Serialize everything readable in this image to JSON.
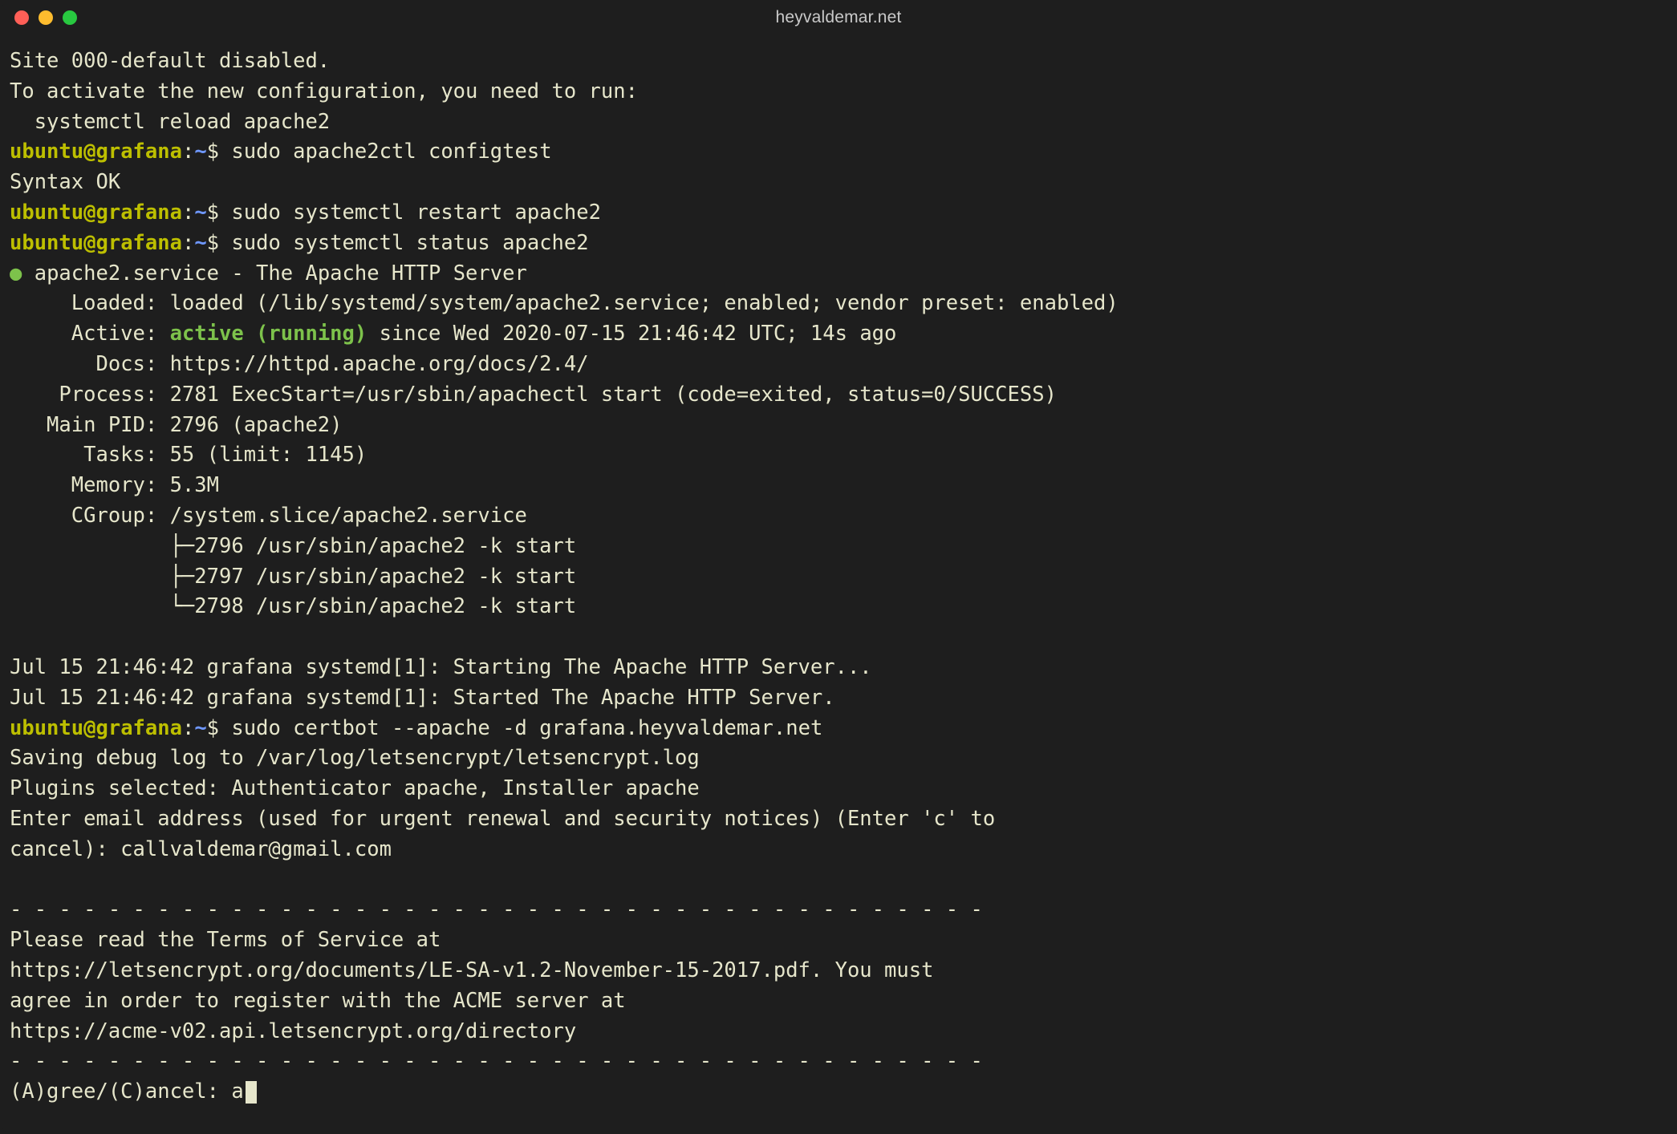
{
  "title": "heyvaldemar.net",
  "colors": {
    "bg": "#1e1e1e",
    "fg": "#e6e6cb",
    "user": "#bdbf00",
    "path": "#6f98ff",
    "active": "#7dc24b",
    "tl_red": "#ff5f57",
    "tl_yellow": "#febc2e",
    "tl_green": "#28c840"
  },
  "prompt": {
    "user": "ubuntu",
    "host": "grafana",
    "sep": "@",
    "colon": ":",
    "path": "~",
    "sigil": "$"
  },
  "l": {
    "l0": "Site 000-default disabled.",
    "l1": "To activate the new configuration, you need to run:",
    "l2": "  systemctl reload apache2",
    "cmd1": " sudo apache2ctl configtest",
    "l4": "Syntax OK",
    "cmd2": " sudo systemctl restart apache2",
    "cmd3": " sudo systemctl status apache2",
    "svc_dot": "●",
    "svc_head": " apache2.service - The Apache HTTP Server",
    "svc_loaded": "     Loaded: loaded (/lib/systemd/system/apache2.service; enabled; vendor preset: enabled)",
    "svc_active_pre": "     Active: ",
    "svc_active": "active (running)",
    "svc_active_post": " since Wed 2020-07-15 21:46:42 UTC; 14s ago",
    "svc_docs": "       Docs: https://httpd.apache.org/docs/2.4/",
    "svc_proc": "    Process: 2781 ExecStart=/usr/sbin/apachectl start (code=exited, status=0/SUCCESS)",
    "svc_mpid": "   Main PID: 2796 (apache2)",
    "svc_tasks": "      Tasks: 55 (limit: 1145)",
    "svc_mem": "     Memory: 5.3M",
    "svc_cgroup": "     CGroup: /system.slice/apache2.service",
    "cg1": "             ├─2796 /usr/sbin/apache2 -k start",
    "cg2": "             ├─2797 /usr/sbin/apache2 -k start",
    "cg3": "             └─2798 /usr/sbin/apache2 -k start",
    "blank": "",
    "log1": "Jul 15 21:46:42 grafana systemd[1]: Starting The Apache HTTP Server...",
    "log2": "Jul 15 21:46:42 grafana systemd[1]: Started The Apache HTTP Server.",
    "cmd4": " sudo certbot --apache -d grafana.heyvaldemar.net",
    "cb1": "Saving debug log to /var/log/letsencrypt/letsencrypt.log",
    "cb2": "Plugins selected: Authenticator apache, Installer apache",
    "cb3": "Enter email address (used for urgent renewal and security notices) (Enter 'c' to",
    "cb4": "cancel): callvaldemar@gmail.com",
    "dashes": "- - - - - - - - - - - - - - - - - - - - - - - - - - - - - - - - - - - - - - - -",
    "tos1": "Please read the Terms of Service at",
    "tos2": "https://letsencrypt.org/documents/LE-SA-v1.2-November-15-2017.pdf. You must",
    "tos3": "agree in order to register with the ACME server at",
    "tos4": "https://acme-v02.api.letsencrypt.org/directory",
    "agree_prompt": "(A)gree/(C)ancel: a"
  }
}
